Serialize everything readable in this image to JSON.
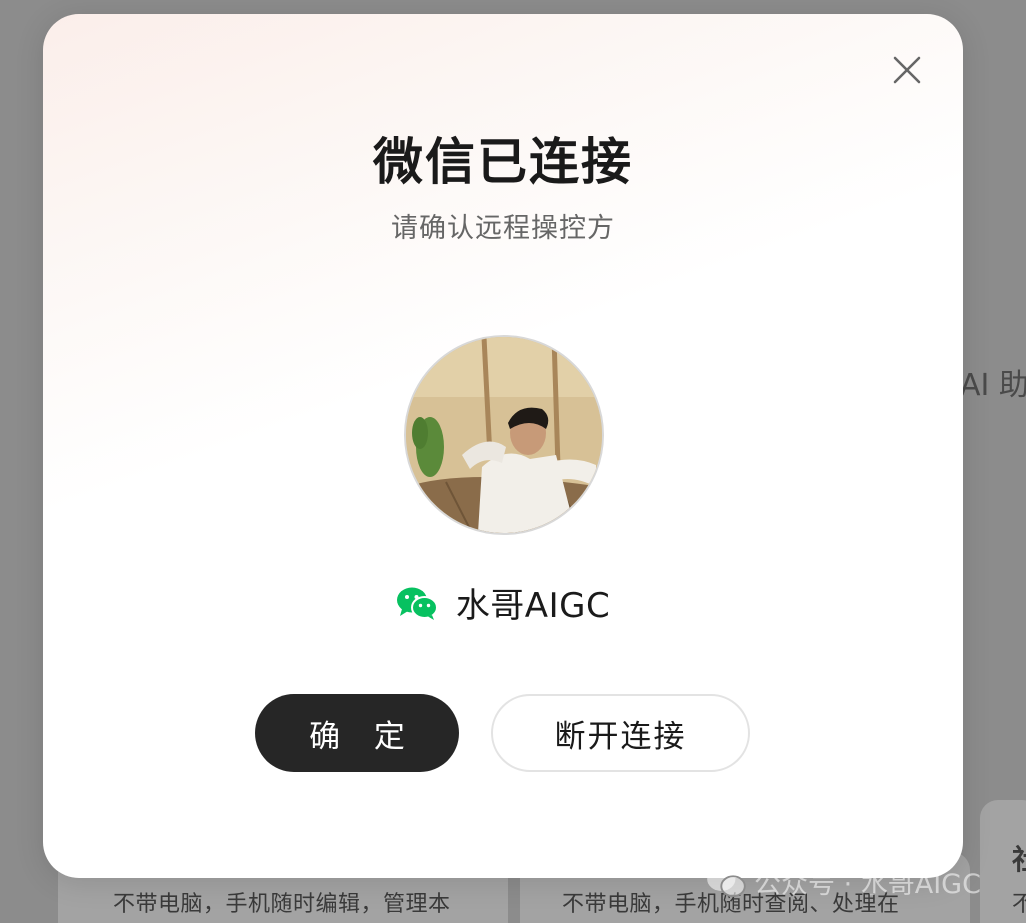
{
  "dialog": {
    "title": "微信已连接",
    "subtitle": "请确认远程操控方",
    "close_icon": "close-icon",
    "user": {
      "platform_icon": "wechat-icon",
      "name": "水哥AIGC",
      "avatar": "avatar-photo"
    },
    "confirm_label": "确 定",
    "disconnect_label": "断开连接"
  },
  "background": {
    "side_text": "AI 助",
    "card_left_text": "不带电脑，手机随时编辑，管理本",
    "card_right_text": "不带电脑，手机随时查阅、处理在",
    "edge_text_top": "社",
    "edge_text_bottom": "不"
  },
  "watermark": {
    "icon": "wechat-icon",
    "text": "公众号 · 水哥AIGC"
  },
  "colors": {
    "overlay": "#8c8c8c",
    "confirm_bg": "#262626",
    "wechat_green": "#07c160"
  }
}
